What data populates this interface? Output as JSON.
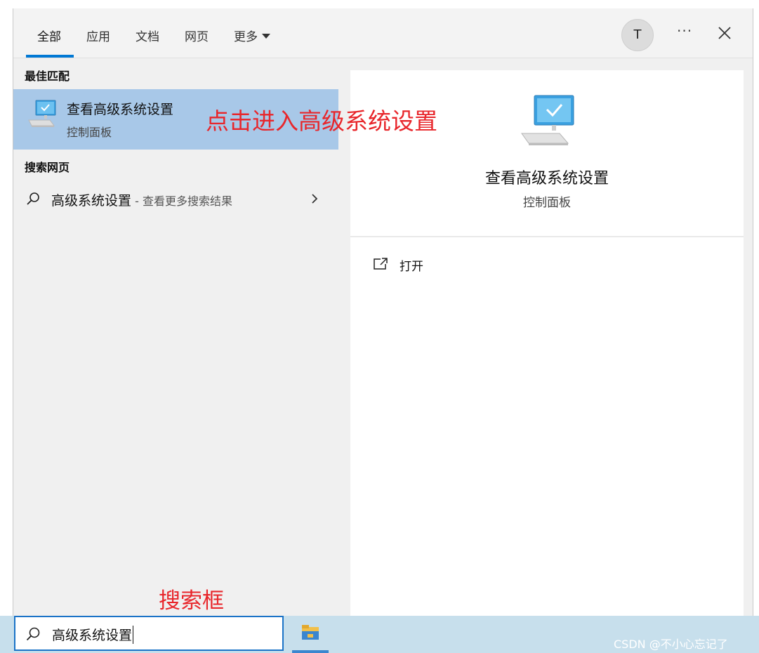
{
  "tabs": {
    "all": "全部",
    "apps": "应用",
    "docs": "文档",
    "web": "网页",
    "more": "更多"
  },
  "account": {
    "avatar_letter": "T",
    "options_label": "···"
  },
  "best_match": {
    "section_title": "最佳匹配",
    "title": "查看高级系统设置",
    "subtitle": "控制面板"
  },
  "web_search": {
    "section_title": "搜索网页",
    "query": "高级系统设置",
    "suffix": " - 查看更多搜索结果"
  },
  "preview": {
    "title": "查看高级系统设置",
    "subtitle": "控制面板",
    "open_label": "打开"
  },
  "annotations": {
    "click_hint": "点击进入高级系统设置",
    "searchbox_hint": "搜索框"
  },
  "taskbar": {
    "search_value": "高级系统设置",
    "watermark": "CSDN @不小心忘记了"
  },
  "colors": {
    "accent": "#0078d4",
    "selected_bg": "#a8c8e8",
    "annotation": "#e8262b",
    "taskbar_bg": "#c7dfec"
  }
}
